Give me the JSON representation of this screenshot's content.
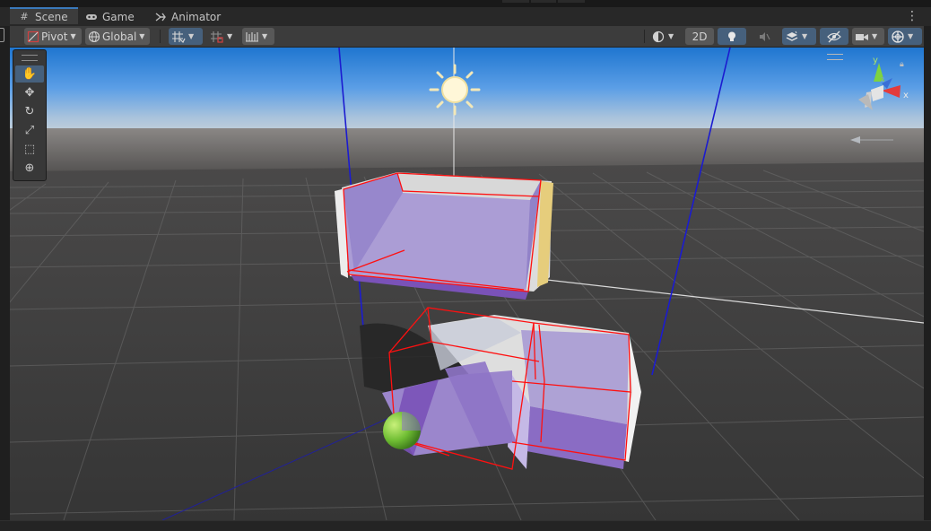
{
  "tabs": [
    {
      "label": "Scene",
      "icon": "grid-icon",
      "active": true
    },
    {
      "label": "Game",
      "icon": "gamepad-icon",
      "active": false
    },
    {
      "label": "Animator",
      "icon": "animator-icon",
      "active": false
    }
  ],
  "toolbar": {
    "pivot_label": "Pivot",
    "global_label": "Global",
    "two_d_label": "2D"
  },
  "tools": [
    {
      "name": "hand-tool-icon",
      "glyph": "✋",
      "active": true
    },
    {
      "name": "move-tool-icon",
      "glyph": "✥",
      "active": false
    },
    {
      "name": "rotate-tool-icon",
      "glyph": "↻",
      "active": false
    },
    {
      "name": "scale-tool-icon",
      "glyph": "⤢",
      "active": false
    },
    {
      "name": "rect-tool-icon",
      "glyph": "⬚",
      "active": false
    },
    {
      "name": "transform-tool-icon",
      "glyph": "⊕",
      "active": false
    }
  ],
  "gizmo": {
    "y_label": "y",
    "x_label": "x",
    "z_label": "z"
  },
  "colors": {
    "accent": "#3a79bb",
    "active_button": "#46607c",
    "selection": "#ff0000",
    "box_fill": "#9b86cc",
    "box_side": "#7a52b8",
    "axis_blue": "#1b1bd0",
    "sphere": "#7ec840"
  }
}
